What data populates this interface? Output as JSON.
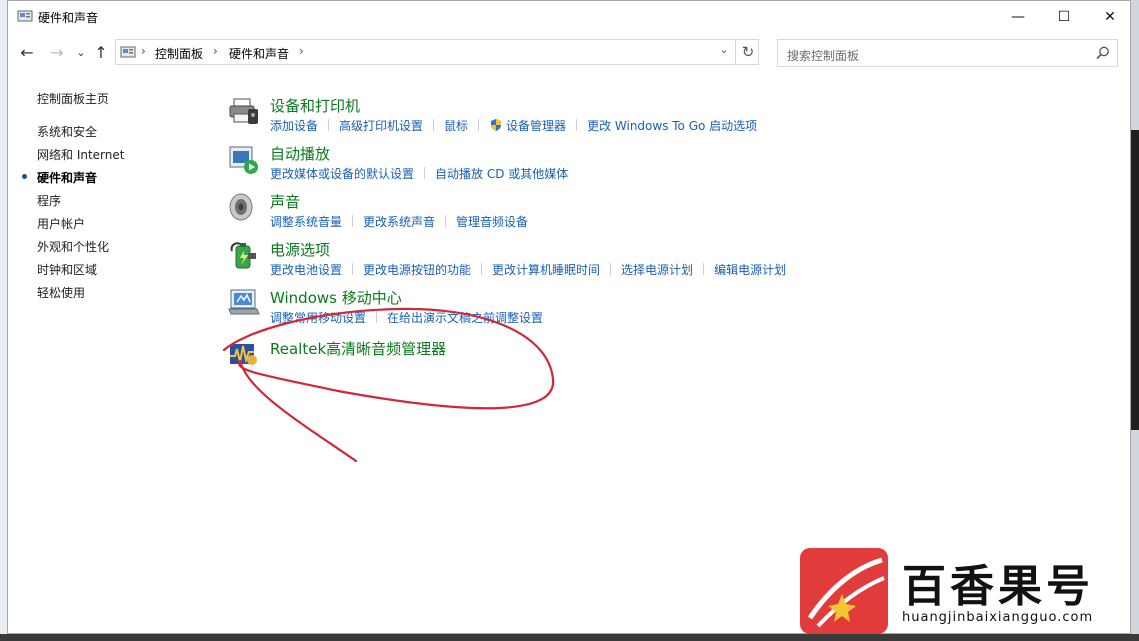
{
  "window": {
    "title": "硬件和声音",
    "controls": {
      "minimize": "—",
      "maximize": "☐",
      "close": "✕"
    }
  },
  "nav": {
    "back": "←",
    "forward": "→",
    "recent": "⌄",
    "up": "↑",
    "breadcrumb": [
      "控制面板",
      "硬件和声音"
    ],
    "breadcrumb_sep": "›",
    "dropdown": "⌄",
    "refresh": "↻",
    "search_placeholder": "搜索控制面板"
  },
  "sidebar": {
    "items": [
      {
        "label": "控制面板主页"
      },
      {
        "label": "系统和安全"
      },
      {
        "label": "网络和 Internet"
      },
      {
        "label": "硬件和声音",
        "current": true
      },
      {
        "label": "程序"
      },
      {
        "label": "用户帐户"
      },
      {
        "label": "外观和个性化"
      },
      {
        "label": "时钟和区域"
      },
      {
        "label": "轻松使用"
      }
    ]
  },
  "categories": [
    {
      "title": "设备和打印机",
      "icon": "printer-icon",
      "links": [
        "添加设备",
        "高级打印机设置",
        "鼠标",
        "设备管理器",
        "更改 Windows To Go 启动选项"
      ]
    },
    {
      "title": "自动播放",
      "icon": "autoplay-icon",
      "links": [
        "更改媒体或设备的默认设置",
        "自动播放 CD 或其他媒体"
      ]
    },
    {
      "title": "声音",
      "icon": "speaker-icon",
      "links": [
        "调整系统音量",
        "更改系统声音",
        "管理音频设备"
      ]
    },
    {
      "title": "电源选项",
      "icon": "power-icon",
      "links": [
        "更改电池设置",
        "更改电源按钮的功能",
        "更改计算机睡眠时间",
        "选择电源计划",
        "编辑电源计划"
      ]
    },
    {
      "title": "Windows 移动中心",
      "icon": "mobility-center-icon",
      "links": [
        "调整常用移动设置",
        "在给出演示文稿之前调整设置"
      ]
    },
    {
      "title": "Realtek高清晰音频管理器",
      "icon": "realtek-audio-icon",
      "links": []
    }
  ],
  "watermark": {
    "text": "百香果号",
    "url": "huangjinbaixiangguo.com"
  },
  "colors": {
    "link": "#1a5fb4",
    "category_title": "#0a7a1e",
    "annotation": "#d0283a",
    "logo_red": "#e23b3b"
  }
}
